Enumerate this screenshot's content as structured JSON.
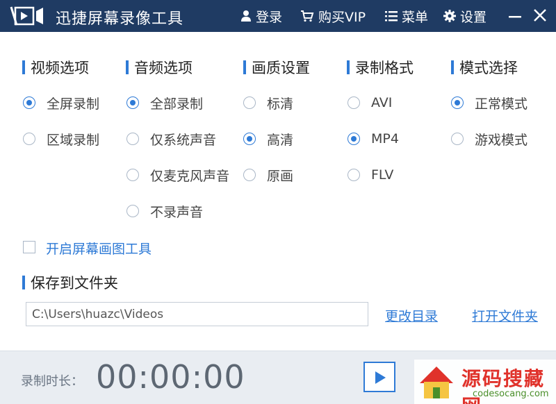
{
  "app": {
    "title": "迅捷屏幕录像工具"
  },
  "titlebar": {
    "login": "登录",
    "vip": "购买VIP",
    "menu": "菜单",
    "settings": "设置"
  },
  "sections": {
    "video": {
      "title": "视频选项",
      "options": [
        "全屏录制",
        "区域录制"
      ],
      "selected": "全屏录制"
    },
    "audio": {
      "title": "音频选项",
      "options": [
        "全部录制",
        "仅系统声音",
        "仅麦克风声音",
        "不录声音"
      ],
      "selected": "全部录制"
    },
    "quality": {
      "title": "画质设置",
      "options": [
        "标清",
        "高清",
        "原画"
      ],
      "selected": "高清"
    },
    "format": {
      "title": "录制格式",
      "options": [
        "AVI",
        "MP4",
        "FLV"
      ],
      "selected": "MP4"
    },
    "mode": {
      "title": "模式选择",
      "options": [
        "正常模式",
        "游戏模式"
      ],
      "selected": "正常模式"
    }
  },
  "drawing_tool": {
    "label": "开启屏幕画图工具",
    "checked": false
  },
  "save": {
    "title": "保存到文件夹",
    "path": "C:\\Users\\huazc\\Videos",
    "change_label": "更改目录",
    "open_label": "打开文件夹"
  },
  "bottom": {
    "duration_label": "录制时长：",
    "duration_value": "00:00:00"
  },
  "watermark": {
    "text": "源码搜藏网",
    "sub": "codesocang.com"
  },
  "colors": {
    "titlebar": "#1f3b63",
    "accent": "#2e7ad6",
    "bottombar": "#e9edf2"
  }
}
